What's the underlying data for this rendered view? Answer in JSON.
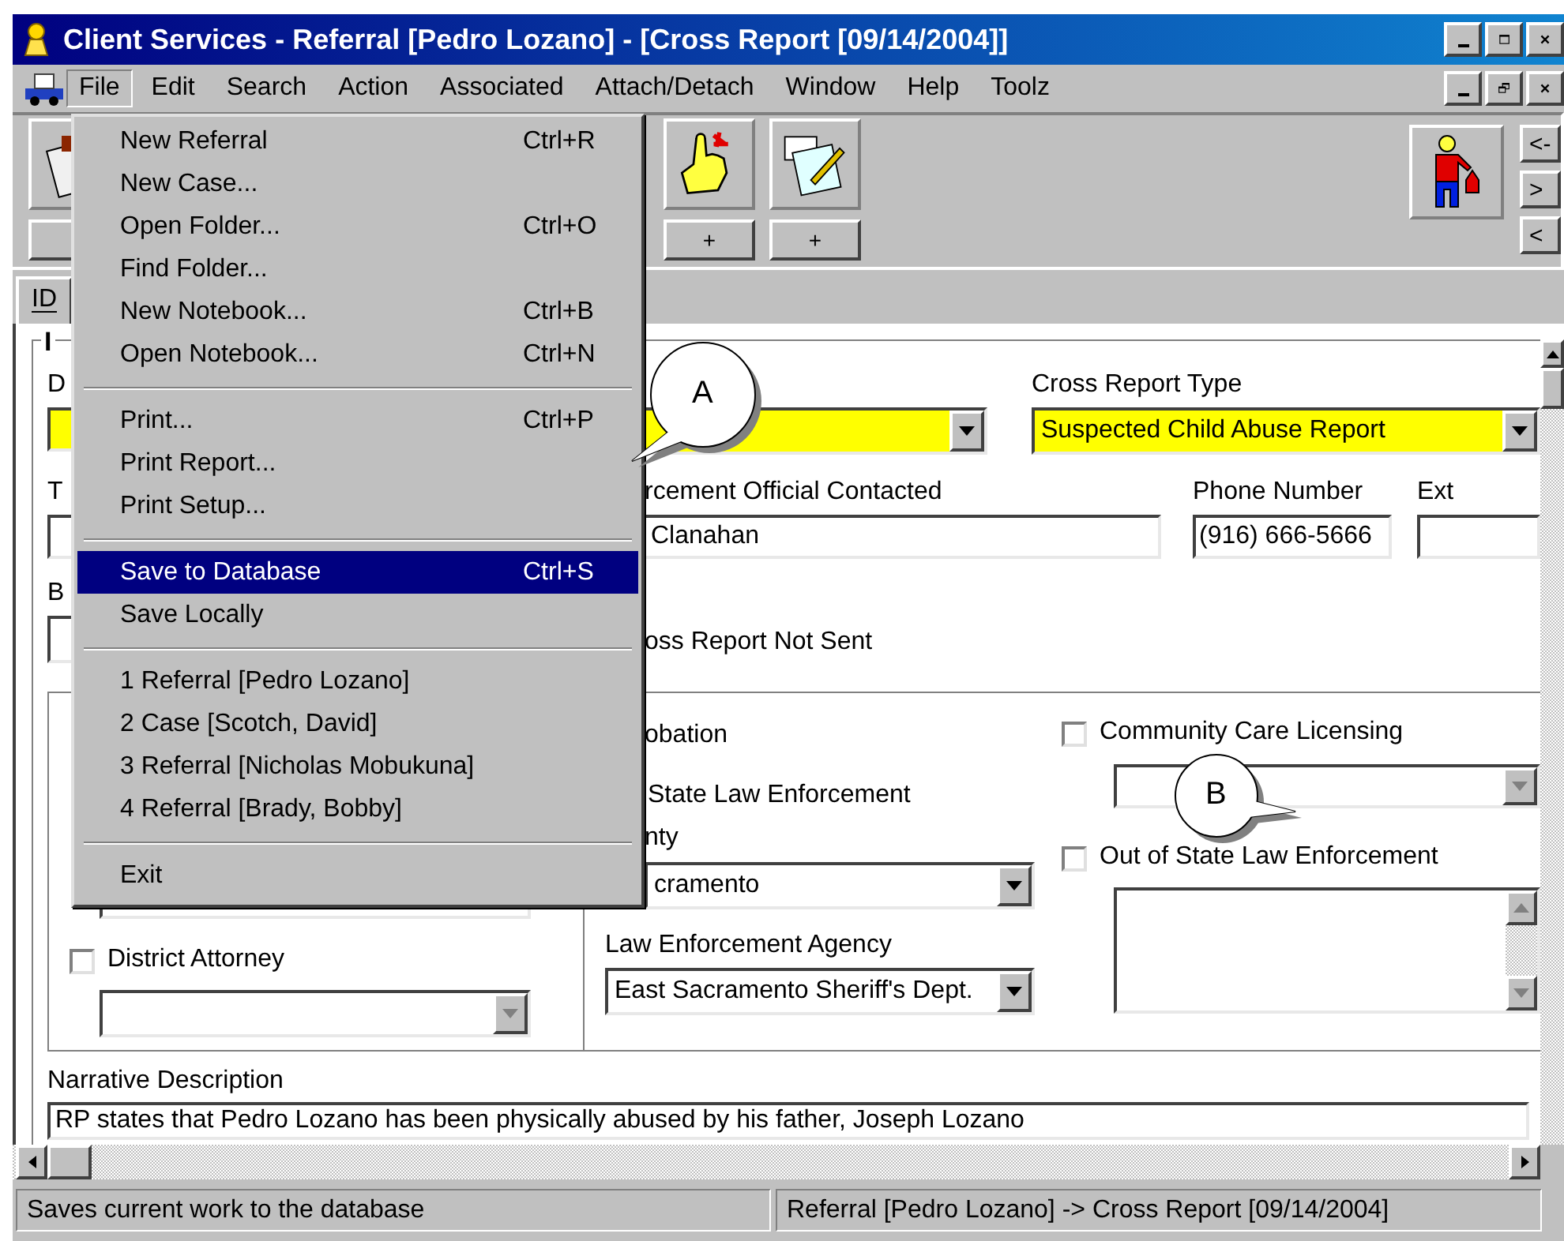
{
  "window": {
    "title": "Client Services - Referral [Pedro Lozano] - [Cross Report [09/14/2004]]"
  },
  "menu_bar": [
    {
      "label": "File",
      "selected": true
    },
    {
      "label": "Edit",
      "selected": false
    },
    {
      "label": "Search",
      "selected": false
    },
    {
      "label": "Action",
      "selected": false
    },
    {
      "label": "Associated",
      "selected": false
    },
    {
      "label": "Attach/Detach",
      "selected": false
    },
    {
      "label": "Window",
      "selected": false
    },
    {
      "label": "Help",
      "selected": false
    },
    {
      "label": "Toolz",
      "selected": false
    }
  ],
  "toolbar": {
    "small_buttons": [
      "+",
      "+"
    ],
    "nav_buttons": [
      "<-",
      ">",
      "<"
    ]
  },
  "tabs": [
    {
      "label": "ID",
      "selected": true
    }
  ],
  "form": {
    "group_title": "I",
    "date": {
      "label": "D",
      "required": true
    },
    "middle_dropdown": {
      "required": true
    },
    "cross_report_type": {
      "label": "Cross Report Type",
      "value": "Suspected Child Abuse Report",
      "required": true
    },
    "field_t": {
      "label": "T"
    },
    "official": {
      "label": "rcement Official Contacted",
      "value": "Clanahan"
    },
    "phone": {
      "label": "Phone Number",
      "value": "(916) 666-5666"
    },
    "ext": {
      "label": "Ext"
    },
    "field_b": {
      "label": "B"
    },
    "not_sent": {
      "label": "oss Report Not Sent"
    },
    "district_attorney": {
      "label": "District Attorney",
      "checked": false,
      "dropdown_disabled": true
    },
    "probation": {
      "label": "obation"
    },
    "state_law": {
      "label": "State Law Enforcement"
    },
    "county": {
      "label": "nty",
      "value": "cramento"
    },
    "agency": {
      "label": "Law Enforcement Agency",
      "value": "East Sacramento Sheriff's Dept."
    },
    "community_care": {
      "label": "Community Care Licensing",
      "checked": false,
      "dropdown_disabled": true
    },
    "out_of_state": {
      "label": "Out of State Law Enforcement",
      "checked": false
    },
    "narrative": {
      "label": "Narrative Description",
      "value": "RP states that Pedro Lozano has been physically abused by his father, Joseph Lozano"
    }
  },
  "file_menu": [
    {
      "kind": "item",
      "label": "New Referral",
      "shortcut": "Ctrl+R",
      "selected": false
    },
    {
      "kind": "item",
      "label": "New Case...",
      "selected": false
    },
    {
      "kind": "item",
      "label": "Open Folder...",
      "shortcut": "Ctrl+O",
      "selected": false
    },
    {
      "kind": "item",
      "label": "Find Folder...",
      "selected": false
    },
    {
      "kind": "item",
      "label": "New Notebook...",
      "shortcut": "Ctrl+B",
      "selected": false
    },
    {
      "kind": "item",
      "label": "Open Notebook...",
      "shortcut": "Ctrl+N",
      "selected": false
    },
    {
      "kind": "separator"
    },
    {
      "kind": "item",
      "label": "Print...",
      "shortcut": "Ctrl+P",
      "selected": false
    },
    {
      "kind": "item",
      "label": "Print Report...",
      "selected": false
    },
    {
      "kind": "item",
      "label": "Print Setup...",
      "selected": false
    },
    {
      "kind": "separator"
    },
    {
      "kind": "item",
      "label": "Save to Database",
      "shortcut": "Ctrl+S",
      "selected": true
    },
    {
      "kind": "item",
      "label": "Save Locally",
      "selected": false
    },
    {
      "kind": "separator"
    },
    {
      "kind": "item",
      "label": "1 Referral [Pedro Lozano]",
      "selected": false
    },
    {
      "kind": "item",
      "label": "2 Case [Scotch, David]",
      "selected": false
    },
    {
      "kind": "item",
      "label": "3 Referral [Nicholas Mobukuna]",
      "selected": false
    },
    {
      "kind": "item",
      "label": "4 Referral [Brady, Bobby]",
      "selected": false
    },
    {
      "kind": "separator"
    },
    {
      "kind": "item",
      "label": "Exit",
      "selected": false
    }
  ],
  "callouts": [
    {
      "label": "A"
    },
    {
      "label": "B"
    }
  ],
  "status_bar": [
    "Saves current work to the database",
    "Referral [Pedro Lozano] -> Cross Report [09/14/2004]"
  ]
}
